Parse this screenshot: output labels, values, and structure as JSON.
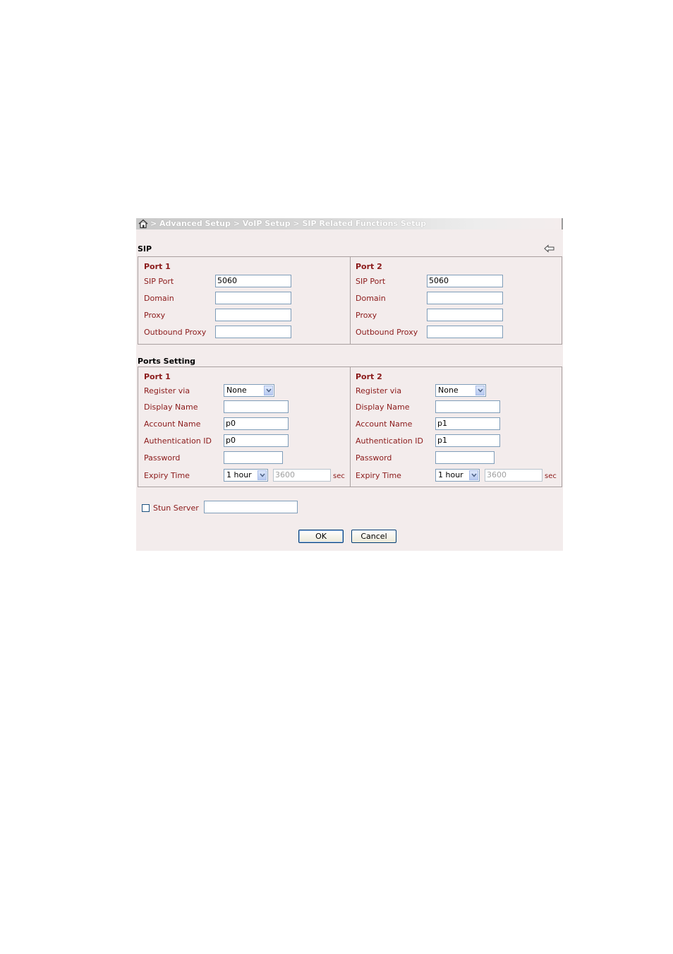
{
  "breadcrumb": {
    "text": "> Advanced Setup > VoIP Setup > SIP Related Functions Setup"
  },
  "sip": {
    "title": "SIP",
    "ports": [
      {
        "header": "Port 1",
        "sip_port_label": "SIP Port",
        "sip_port_value": "5060",
        "domain_label": "Domain",
        "domain_value": "",
        "proxy_label": "Proxy",
        "proxy_value": "",
        "outbound_proxy_label": "Outbound Proxy",
        "outbound_proxy_value": ""
      },
      {
        "header": "Port 2",
        "sip_port_label": "SIP Port",
        "sip_port_value": "5060",
        "domain_label": "Domain",
        "domain_value": "",
        "proxy_label": "Proxy",
        "proxy_value": "",
        "outbound_proxy_label": "Outbound Proxy",
        "outbound_proxy_value": ""
      }
    ]
  },
  "ports_setting": {
    "title": "Ports Setting",
    "ports": [
      {
        "header": "Port 1",
        "register_via_label": "Register via",
        "register_via_value": "None",
        "display_name_label": "Display Name",
        "display_name_value": "",
        "account_name_label": "Account Name",
        "account_name_value": "p0",
        "auth_id_label": "Authentication ID",
        "auth_id_value": "p0",
        "password_label": "Password",
        "password_value": "",
        "expiry_label": "Expiry Time",
        "expiry_select": "1 hour",
        "expiry_seconds": "3600",
        "sec_label": "sec"
      },
      {
        "header": "Port 2",
        "register_via_label": "Register via",
        "register_via_value": "None",
        "display_name_label": "Display Name",
        "display_name_value": "",
        "account_name_label": "Account Name",
        "account_name_value": "p1",
        "auth_id_label": "Authentication ID",
        "auth_id_value": "p1",
        "password_label": "Password",
        "password_value": "",
        "expiry_label": "Expiry Time",
        "expiry_select": "1 hour",
        "expiry_seconds": "3600",
        "sec_label": "sec"
      }
    ]
  },
  "stun": {
    "label": "Stun Server",
    "value": "",
    "checked": false
  },
  "buttons": {
    "ok": "OK",
    "cancel": "Cancel"
  },
  "colors": {
    "label": "#8b1a1a",
    "panel_bg": "#f3ecec",
    "border": "#a9a0a0"
  }
}
